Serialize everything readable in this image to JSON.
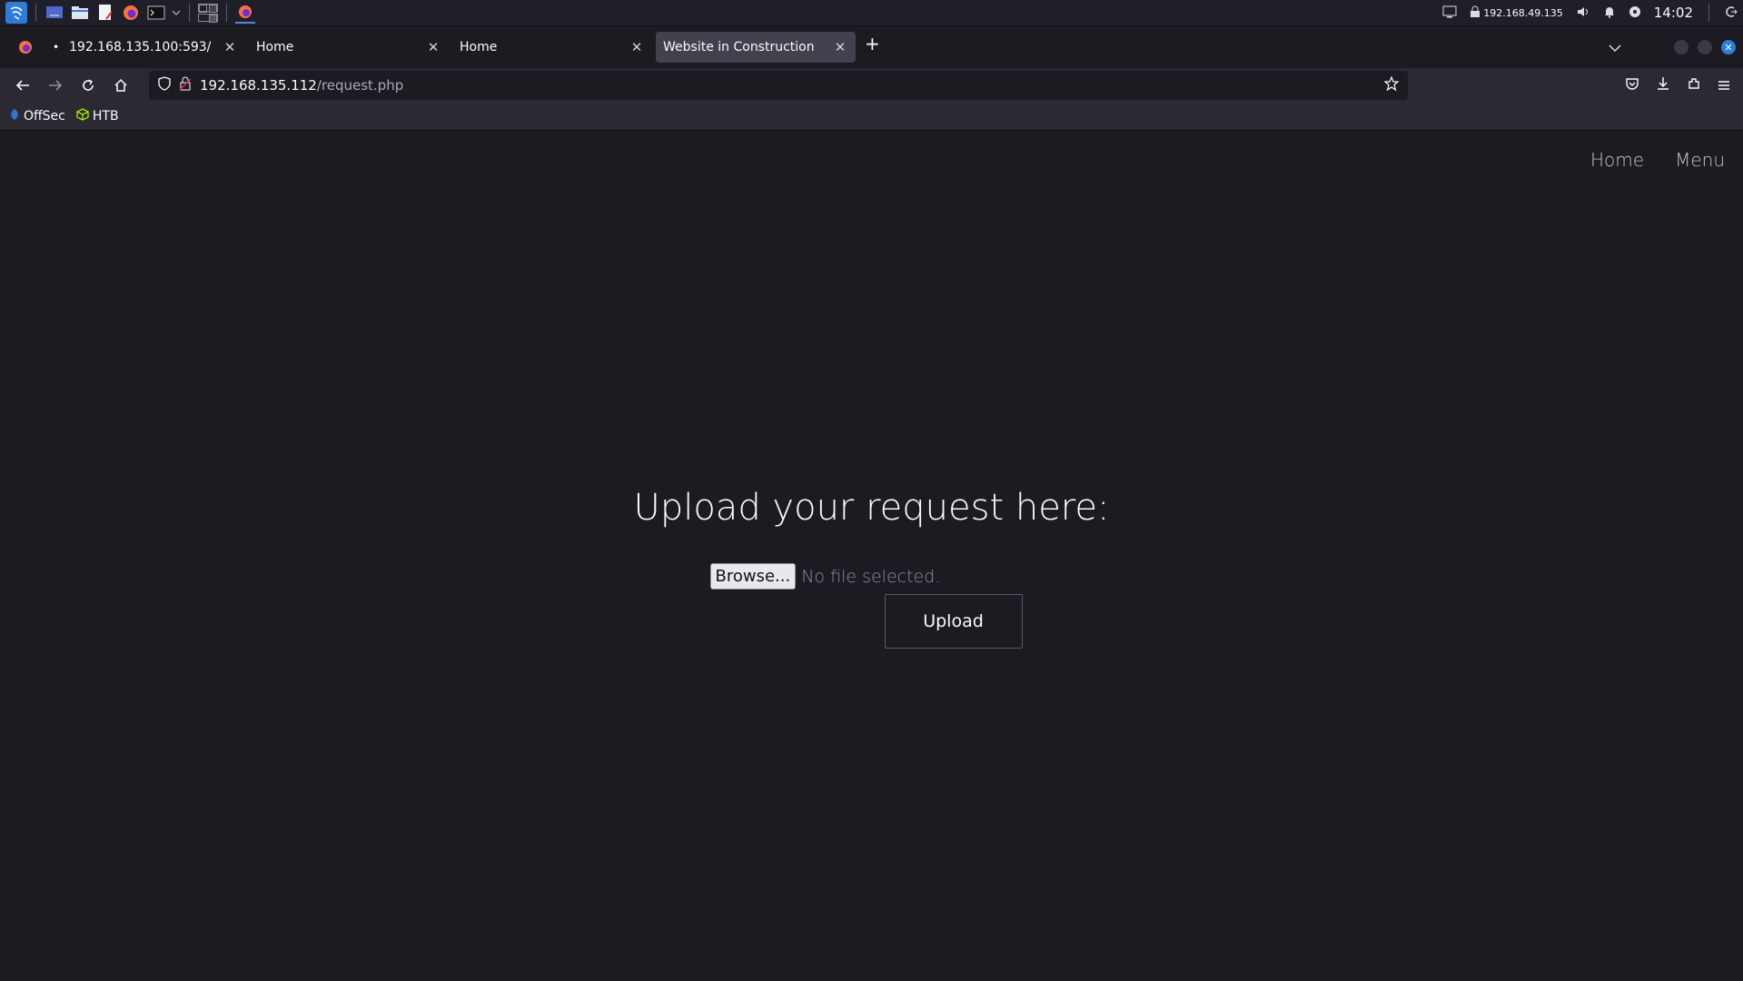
{
  "taskbar": {
    "ip": "192.168.49.135",
    "time": "14:02"
  },
  "browser": {
    "tabs": [
      {
        "label": "192.168.135.100:593/",
        "active": false
      },
      {
        "label": "Home",
        "active": false
      },
      {
        "label": "Home",
        "active": false
      },
      {
        "label": "Website in Construction",
        "active": true
      }
    ],
    "url_host": "192.168.135.112",
    "url_path": "/request.php",
    "bookmarks": [
      {
        "label": "OffSec"
      },
      {
        "label": "HTB"
      }
    ]
  },
  "page": {
    "nav": {
      "home": "Home",
      "menu": "Menu"
    },
    "heading": "Upload your request here:",
    "browse_label": "Browse...",
    "file_status": "No file selected.",
    "upload_label": "Upload"
  },
  "colors": {
    "page_bg": "#1c1b22",
    "chrome_bg": "#2b2a33",
    "accent": "#2b7fd6"
  }
}
